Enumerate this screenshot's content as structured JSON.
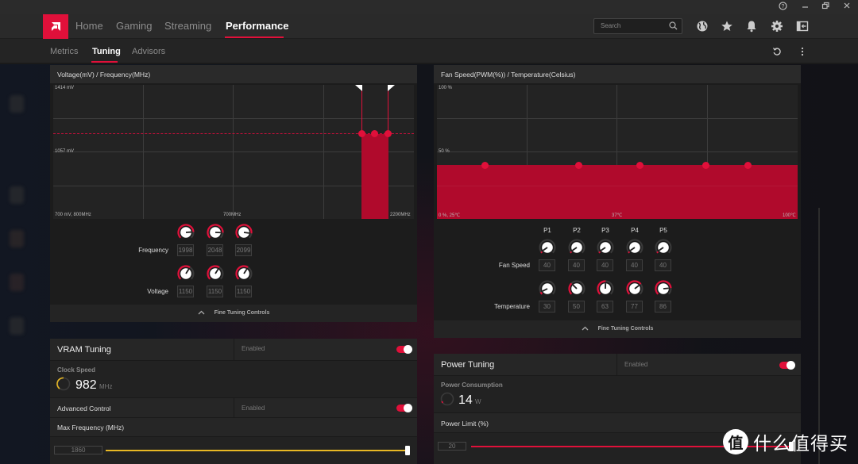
{
  "window": {
    "controls": [
      "help",
      "minimize",
      "restore",
      "close"
    ]
  },
  "nav": {
    "logo": "amd-logo",
    "items": [
      {
        "label": "Home",
        "active": false
      },
      {
        "label": "Gaming",
        "active": false
      },
      {
        "label": "Streaming",
        "active": false
      },
      {
        "label": "Performance",
        "active": true
      }
    ],
    "search_placeholder": "Search",
    "icons": [
      "globe-icon",
      "star-icon",
      "bell-icon",
      "gear-icon",
      "layout-icon"
    ]
  },
  "subnav": {
    "items": [
      {
        "label": "Metrics",
        "active": false
      },
      {
        "label": "Tuning",
        "active": true
      },
      {
        "label": "Advisors",
        "active": false
      }
    ],
    "actions": [
      "reset-icon",
      "more-icon"
    ]
  },
  "colors": {
    "accent": "#e0103a",
    "fill": "#b00a2c",
    "vram_accent": "#e8b824"
  },
  "gpu_tuning": {
    "title": "Voltage(mV) / Frequency(MHz)",
    "chart_labels": {
      "y_top": "1414 mV",
      "y_mid": "1057 mV",
      "origin": "700 mV, 800MHz",
      "x_mid": "700MHz",
      "x_max": "2200MHz"
    },
    "frequency_label": "Frequency",
    "voltage_label": "Voltage",
    "frequency_values": [
      "1998",
      "2048",
      "2099"
    ],
    "voltage_values": [
      "1150",
      "1150",
      "1150"
    ],
    "fine_tuning_label": "Fine Tuning Controls"
  },
  "fan_tuning": {
    "title": "Fan Speed(PWM(%)) / Temperature(Celsius)",
    "chart_labels": {
      "y_top": "100 %",
      "y_mid": "50 %",
      "origin": "0 %, 25℃",
      "x_mid": "37℃",
      "x_max": "100℃"
    },
    "points": [
      "P1",
      "P2",
      "P3",
      "P4",
      "P5"
    ],
    "fan_speed_label": "Fan Speed",
    "temperature_label": "Temperature",
    "fan_speed_values": [
      "40",
      "40",
      "40",
      "40",
      "40"
    ],
    "temperature_values": [
      "30",
      "50",
      "63",
      "77",
      "86"
    ],
    "fine_tuning_label": "Fine Tuning Controls"
  },
  "vram": {
    "title": "VRAM Tuning",
    "status": "Enabled",
    "enabled": true,
    "clock_label": "Clock Speed",
    "clock_value": "982",
    "clock_unit": "MHz",
    "advanced_label": "Advanced Control",
    "advanced_status": "Enabled",
    "advanced_enabled": true,
    "max_freq_label": "Max Frequency (MHz)",
    "max_freq_value": "1860",
    "max_freq_slider_fraction": 1.0
  },
  "power": {
    "title": "Power Tuning",
    "status": "Enabled",
    "enabled": true,
    "consumption_label": "Power Consumption",
    "consumption_value": "14",
    "consumption_unit": "W",
    "limit_label": "Power Limit (%)",
    "limit_value": "20",
    "limit_slider_fraction": 1.0
  },
  "watermark": {
    "badge": "值",
    "text": "什么值得买"
  }
}
